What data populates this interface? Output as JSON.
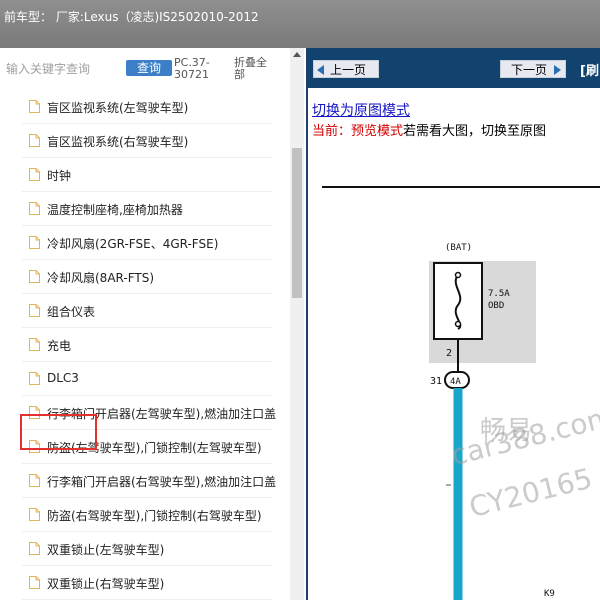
{
  "window": {
    "title": "前车型： 厂家:Lexus（凌志)IS2502010-2012"
  },
  "left_panel": {
    "search": {
      "placeholder": "输入关键字查询",
      "button_label": "查询",
      "pc_code": "PC.37-30721",
      "fold_all_label": "折叠全部"
    },
    "items": [
      {
        "label": "盲区监视系统(左驾驶车型)"
      },
      {
        "label": "盲区监视系统(右驾驶车型)"
      },
      {
        "label": "时钟"
      },
      {
        "label": "温度控制座椅,座椅加热器"
      },
      {
        "label": "冷却风扇(2GR-FSE、4GR-FSE)"
      },
      {
        "label": "冷却风扇(8AR-FTS)"
      },
      {
        "label": "组合仪表"
      },
      {
        "label": "充电"
      },
      {
        "label": "DLC3"
      },
      {
        "label": "行李箱门开启器(左驾驶车型),燃油加注口盖"
      },
      {
        "label": "防盗(左驾驶车型),门锁控制(左驾驶车型)"
      },
      {
        "label": "行李箱门开启器(右驾驶车型),燃油加注口盖"
      },
      {
        "label": "防盗(右驾驶车型),门锁控制(右驾驶车型)"
      },
      {
        "label": "双重锁止(左驾驶车型)"
      },
      {
        "label": "双重锁止(右驾驶车型)"
      }
    ],
    "highlighted_item": "DLC3"
  },
  "right_panel": {
    "nav": {
      "prev_label": "上一页",
      "next_label": "下一页",
      "print_label": "[刷"
    },
    "switch_link": "切换为原图模式",
    "status": {
      "prefix": "当前：",
      "mode": "预览模式",
      "hint": "若需看大图，切换至原图"
    },
    "diagram": {
      "bat_label": "(BAT)",
      "fuse_rating": "7.5A",
      "fuse_name": "OBD",
      "pin_top": "2",
      "connector_pin": "31",
      "connector_id": "4A",
      "bottom_label": "K9"
    },
    "watermark": {
      "line1": "畅易",
      "line2": "car388.com",
      "line3": "CY20165"
    }
  },
  "colors": {
    "topbar": "#878787",
    "navbar": "#12436f",
    "query_button": "#3c7fc6",
    "highlight_border": "#e53030",
    "wire": "#1aa6c8"
  }
}
